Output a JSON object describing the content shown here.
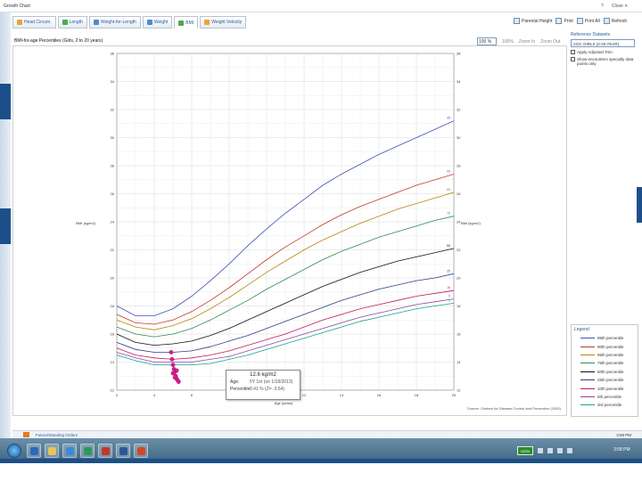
{
  "window": {
    "title": "Growth Chart",
    "help": "?",
    "close": "Close ✕"
  },
  "tabs": [
    {
      "label": "Head Circum.",
      "icon": "head-circumference-icon"
    },
    {
      "label": "Length",
      "icon": "length-icon"
    },
    {
      "label": "Weight-for-Length",
      "icon": "weight-for-length-icon"
    },
    {
      "label": "Weight",
      "icon": "weight-icon"
    },
    {
      "label": "BMI",
      "icon": "bmi-icon"
    },
    {
      "label": "Weight Velocity",
      "icon": "weight-velocity-icon"
    }
  ],
  "toolbar": {
    "parental_height": "Parental Height",
    "print": "Print",
    "print_all": "Print All",
    "refresh": "Refresh"
  },
  "chart_title": "BMI-for-age Percentiles (Girls, 2 to 20 years)",
  "zoom": {
    "value": "100 %",
    "reset": "100%",
    "zoom_in": "Zoom In",
    "zoom_out": "Zoom Out"
  },
  "side_panel": {
    "reference_label": "Reference Datasets",
    "dataset": "CDC GIRLS (2-20 YEAR)",
    "apply_trim": "Apply Adjusted Trim",
    "show_only": "Show encounters specially data points only"
  },
  "tooltip": {
    "value": "12.6 kg/m2",
    "age_label": "Age:",
    "age_value": "5Y 1m (on 1/18/2013)",
    "percentile_label": "Percentile:",
    "percentile_value": "0.41 % (Z= -2.64)"
  },
  "source_note": "Source: Centers for Disease Control and Prevention (2000)",
  "status": {
    "text": "Future/Standing Orders",
    "time": "3:58 PM"
  },
  "taskbar": {
    "badge": "100%",
    "clock": "3:58 PM"
  },
  "legend": {
    "title": "Legend",
    "items": [
      {
        "label": "95th percentile",
        "color": "#3f51b5"
      },
      {
        "label": "90th percentile",
        "color": "#c0392b"
      },
      {
        "label": "85th percentile",
        "color": "#b8860b"
      },
      {
        "label": "75th percentile",
        "color": "#2e8b57"
      },
      {
        "label": "50th percentile",
        "color": "#111111"
      },
      {
        "label": "25th percentile",
        "color": "#2c3e90"
      },
      {
        "label": "10th percentile",
        "color": "#c2185b"
      },
      {
        "label": "5th percentile",
        "color": "#8e44ad"
      },
      {
        "label": "3rd percentile",
        "color": "#17a589"
      }
    ]
  },
  "chart_data": {
    "type": "line",
    "title": "BMI-for-age Percentiles (Girls, 2 to 20 years)",
    "xlabel": "Age (years)",
    "ylabel": "BMI (kg/m2)",
    "xlim": [
      2,
      20
    ],
    "ylim": [
      12,
      36
    ],
    "x_ticks": [
      2,
      4,
      6,
      8,
      10,
      12,
      14,
      16,
      18,
      20
    ],
    "y_ticks": [
      12,
      14,
      16,
      18,
      20,
      22,
      24,
      26,
      28,
      30,
      32,
      34,
      36
    ],
    "grid": true,
    "x": [
      2,
      3,
      4,
      5,
      6,
      7,
      8,
      9,
      10,
      11,
      12,
      13,
      14,
      15,
      16,
      17,
      18,
      19,
      20
    ],
    "series": [
      {
        "name": "95th percentile",
        "line_label": "95",
        "color": "#3f51b5",
        "values": [
          18.0,
          17.3,
          17.3,
          17.8,
          18.7,
          19.8,
          21.0,
          22.3,
          23.5,
          24.6,
          25.6,
          26.6,
          27.4,
          28.1,
          28.8,
          29.4,
          30.0,
          30.6,
          31.2
        ]
      },
      {
        "name": "90th percentile",
        "line_label": "90",
        "color": "#c0392b",
        "values": [
          17.4,
          16.8,
          16.7,
          17.0,
          17.6,
          18.4,
          19.3,
          20.3,
          21.3,
          22.2,
          23.0,
          23.8,
          24.5,
          25.1,
          25.6,
          26.1,
          26.6,
          27.0,
          27.4
        ]
      },
      {
        "name": "85th percentile",
        "line_label": "85",
        "color": "#b8860b",
        "values": [
          17.0,
          16.5,
          16.3,
          16.6,
          17.1,
          17.8,
          18.6,
          19.5,
          20.4,
          21.2,
          22.0,
          22.7,
          23.3,
          23.9,
          24.4,
          24.9,
          25.3,
          25.7,
          26.1
        ]
      },
      {
        "name": "75th percentile",
        "line_label": "75",
        "color": "#2e8b57",
        "values": [
          16.5,
          16.0,
          15.8,
          16.0,
          16.4,
          17.0,
          17.7,
          18.4,
          19.2,
          19.9,
          20.6,
          21.3,
          21.9,
          22.4,
          22.9,
          23.3,
          23.7,
          24.1,
          24.4
        ]
      },
      {
        "name": "50th percentile",
        "line_label": "50",
        "color": "#111111",
        "values": [
          16.0,
          15.4,
          15.2,
          15.3,
          15.5,
          15.9,
          16.4,
          17.0,
          17.6,
          18.2,
          18.8,
          19.4,
          19.9,
          20.4,
          20.8,
          21.2,
          21.5,
          21.8,
          22.1
        ]
      },
      {
        "name": "25th percentile",
        "line_label": "25",
        "color": "#2c3e90",
        "values": [
          15.4,
          14.9,
          14.7,
          14.7,
          14.8,
          15.1,
          15.5,
          15.9,
          16.4,
          16.9,
          17.4,
          17.9,
          18.4,
          18.8,
          19.2,
          19.5,
          19.8,
          20.0,
          20.3
        ]
      },
      {
        "name": "10th percentile",
        "line_label": "10",
        "color": "#c2185b",
        "values": [
          15.0,
          14.5,
          14.3,
          14.2,
          14.3,
          14.5,
          14.8,
          15.2,
          15.6,
          16.0,
          16.5,
          17.0,
          17.4,
          17.8,
          18.1,
          18.4,
          18.7,
          18.9,
          19.1
        ]
      },
      {
        "name": "5th percentile",
        "line_label": "5",
        "color": "#8e44ad",
        "values": [
          14.7,
          14.3,
          14.0,
          14.0,
          14.0,
          14.2,
          14.4,
          14.8,
          15.2,
          15.6,
          16.0,
          16.4,
          16.8,
          17.2,
          17.5,
          17.8,
          18.1,
          18.3,
          18.5
        ]
      },
      {
        "name": "3rd percentile",
        "line_label": "3",
        "color": "#17a589",
        "values": [
          14.5,
          14.1,
          13.8,
          13.8,
          13.8,
          13.9,
          14.2,
          14.5,
          14.9,
          15.3,
          15.7,
          16.1,
          16.5,
          16.9,
          17.2,
          17.5,
          17.8,
          18.0,
          18.2
        ]
      }
    ],
    "patient_points": {
      "name": "Patient measurements",
      "color": "#d81b8c",
      "x": [
        4.9,
        4.95,
        5.0,
        5.05,
        5.1,
        5.15,
        5.2,
        5.25,
        5.3,
        5.0,
        5.1,
        5.2
      ],
      "y": [
        14.7,
        14.2,
        13.8,
        13.5,
        13.3,
        13.0,
        12.8,
        12.7,
        12.6,
        13.2,
        12.9,
        13.4
      ]
    }
  }
}
